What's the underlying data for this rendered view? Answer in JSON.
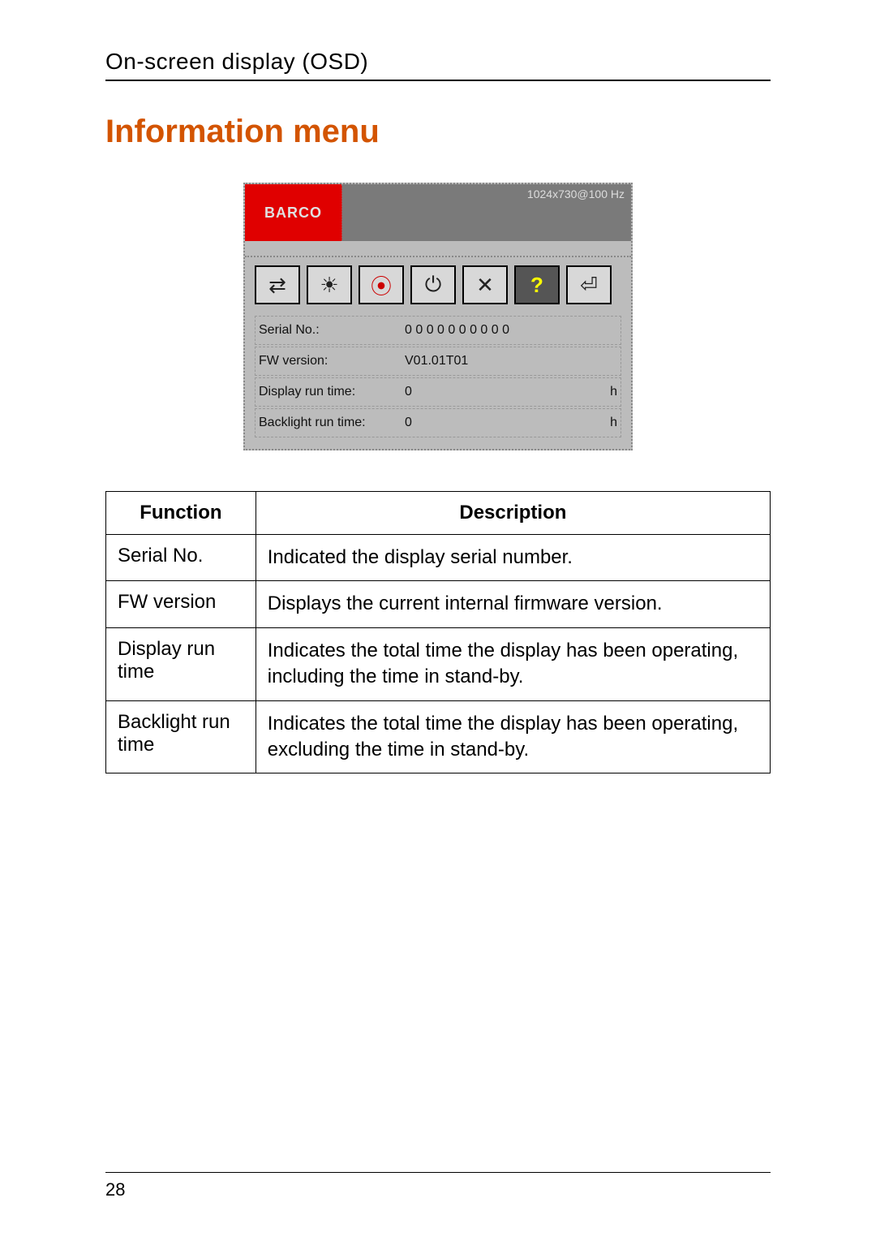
{
  "header": {
    "section_title": "On-screen display (OSD)"
  },
  "title": "Information menu",
  "osd": {
    "logo": "BARCO",
    "status_text": "1024x730@100 Hz",
    "icons": [
      {
        "name": "adjust-icon",
        "glyph": "⇄"
      },
      {
        "name": "brightness-icon",
        "glyph": "☀"
      },
      {
        "name": "color-icon",
        "glyph": "⦿"
      },
      {
        "name": "power-icon",
        "glyph": "⏻"
      },
      {
        "name": "tools-icon",
        "glyph": "✕"
      },
      {
        "name": "info-icon",
        "glyph": "?"
      },
      {
        "name": "exit-icon",
        "glyph": "⏎"
      }
    ],
    "rows": [
      {
        "label": "Serial No.:",
        "value": "0 0 0 0 0 0 0 0 0 0",
        "unit": ""
      },
      {
        "label": "FW version:",
        "value": "V01.01T01",
        "unit": ""
      },
      {
        "label": "Display run time:",
        "value": "0",
        "unit": "h"
      },
      {
        "label": "Backlight run time:",
        "value": "0",
        "unit": "h"
      }
    ]
  },
  "table": {
    "headers": {
      "function": "Function",
      "description": "Description"
    },
    "rows": [
      {
        "function": "Serial No.",
        "description": "Indicated the display serial number."
      },
      {
        "function": "FW version",
        "description": "Displays the current internal firmware version."
      },
      {
        "function": "Display run time",
        "description": "Indicates the total time the display has been operating, including the time in stand-by."
      },
      {
        "function": "Backlight run time",
        "description": "Indicates the total time the display has been operating, excluding the time in stand-by."
      }
    ]
  },
  "page_number": "28"
}
